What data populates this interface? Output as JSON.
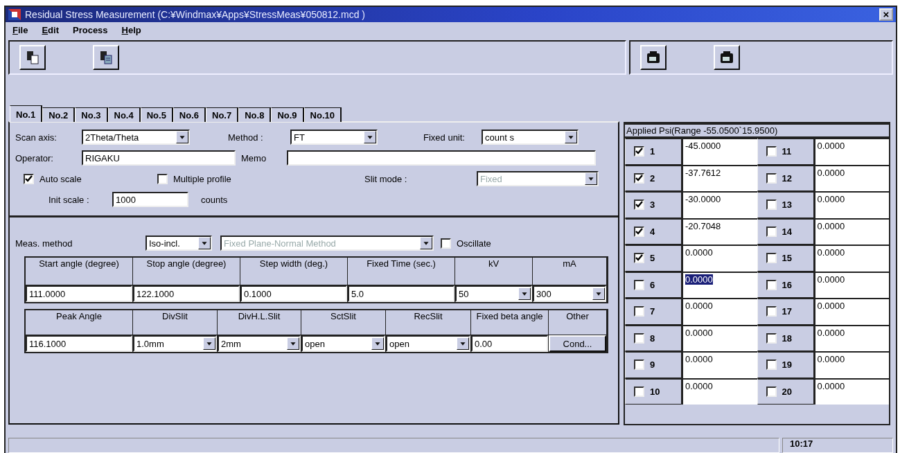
{
  "window": {
    "title": "Residual Stress Measurement (C:¥Windmax¥Apps¥StressMeas¥050812.mcd )",
    "close": "×"
  },
  "menu": [
    {
      "label": "File",
      "underline_first": true
    },
    {
      "label": "Edit",
      "underline_first": true
    },
    {
      "label": "Process",
      "underline_first": false
    },
    {
      "label": "Help",
      "underline_first": true
    }
  ],
  "toolbar": {
    "left": [
      {
        "kind": "copy"
      },
      {
        "kind": "paste"
      }
    ],
    "right": [
      {
        "kind": "camera"
      },
      {
        "kind": "camera"
      }
    ]
  },
  "tabs": [
    {
      "label": "No.1",
      "selected": true
    },
    {
      "label": "No.2",
      "selected": false
    },
    {
      "label": "No.3",
      "selected": false
    },
    {
      "label": "No.4",
      "selected": false
    },
    {
      "label": "No.5",
      "selected": false
    },
    {
      "label": "No.6",
      "selected": false
    },
    {
      "label": "No.7",
      "selected": false
    },
    {
      "label": "No.8",
      "selected": false
    },
    {
      "label": "No.9",
      "selected": false
    },
    {
      "label": "No.10",
      "selected": false
    }
  ],
  "settings": {
    "scan_axis": {
      "label": "Scan axis:",
      "value": "2Theta/Theta"
    },
    "method": {
      "label": "Method  :",
      "value": "FT"
    },
    "fixed_unit": {
      "label": "Fixed unit:",
      "value": "count s"
    },
    "operator": {
      "label": "Operator:",
      "value": "RIGAKU"
    },
    "memo": {
      "label": "Memo"
    },
    "auto_scale": {
      "label": "Auto scale",
      "checked": true
    },
    "multiple_profile": {
      "label": "Multiple profile",
      "checked": false
    },
    "slit_mode": {
      "label": "Slit mode :",
      "value": "Fixed",
      "disabled": true
    },
    "init_scale": {
      "label": "Init scale :",
      "value": "1000",
      "unit": "counts"
    }
  },
  "measurement": {
    "meas_method": {
      "label": "Meas. method",
      "value": "Iso-incl."
    },
    "plane_method": {
      "value": "Fixed Plane-Normal Method",
      "disabled": true
    },
    "oscillate": {
      "label": "Oscillate",
      "checked": false
    },
    "angle_table": [
      {
        "header": "Start angle (degree)",
        "value": "111.0000",
        "kind": "text"
      },
      {
        "header": "Stop angle (degree)",
        "value": "122.1000",
        "kind": "text"
      },
      {
        "header": "Step width (deg.)",
        "value": "0.1000",
        "kind": "text"
      },
      {
        "header": "Fixed Time (sec.)",
        "value": "5.0",
        "kind": "text"
      },
      {
        "header": "kV",
        "value": "50",
        "kind": "dropdown"
      },
      {
        "header": "mA",
        "value": "300",
        "kind": "dropdown"
      }
    ],
    "slit_table": [
      {
        "header": "Peak Angle",
        "value": "116.1000",
        "kind": "text"
      },
      {
        "header": "DivSlit",
        "value": "1.0mm",
        "kind": "dropdown"
      },
      {
        "header": "DivH.L.Slit",
        "value": "2mm",
        "kind": "dropdown"
      },
      {
        "header": "SctSlit",
        "value": "open",
        "kind": "dropdown"
      },
      {
        "header": "RecSlit",
        "value": "open",
        "kind": "dropdown"
      },
      {
        "header": "Fixed beta angle",
        "value": "0.00",
        "kind": "text"
      },
      {
        "header": "Other",
        "value": "Cond...",
        "kind": "button"
      }
    ]
  },
  "psi": {
    "title": "Applied Psi(Range -55.0500`15.9500)",
    "rows": [
      {
        "number": "1",
        "checked": true,
        "value": "-45.0000",
        "selected": false
      },
      {
        "number": "2",
        "checked": true,
        "value": "-37.7612",
        "selected": false
      },
      {
        "number": "3",
        "checked": true,
        "value": "-30.0000",
        "selected": false
      },
      {
        "number": "4",
        "checked": true,
        "value": "-20.7048",
        "selected": false
      },
      {
        "number": "5",
        "checked": true,
        "value": "0.0000",
        "selected": false
      },
      {
        "number": "6",
        "checked": false,
        "value": "0.0000",
        "selected": true
      },
      {
        "number": "7",
        "checked": false,
        "value": "0.0000",
        "selected": false
      },
      {
        "number": "8",
        "checked": false,
        "value": "0.0000",
        "selected": false
      },
      {
        "number": "9",
        "checked": false,
        "value": "0.0000",
        "selected": false
      },
      {
        "number": "10",
        "checked": false,
        "value": "0.0000",
        "selected": false
      },
      {
        "number": "11",
        "checked": false,
        "value": "0.0000",
        "selected": false
      },
      {
        "number": "12",
        "checked": false,
        "value": "0.0000",
        "selected": false
      },
      {
        "number": "13",
        "checked": false,
        "value": "0.0000",
        "selected": false
      },
      {
        "number": "14",
        "checked": false,
        "value": "0.0000",
        "selected": false
      },
      {
        "number": "15",
        "checked": false,
        "value": "0.0000",
        "selected": false
      },
      {
        "number": "16",
        "checked": false,
        "value": "0.0000",
        "selected": false
      },
      {
        "number": "17",
        "checked": false,
        "value": "0.0000",
        "selected": false
      },
      {
        "number": "18",
        "checked": false,
        "value": "0.0000",
        "selected": false
      },
      {
        "number": "19",
        "checked": false,
        "value": "0.0000",
        "selected": false
      },
      {
        "number": "20",
        "checked": false,
        "value": "0.0000",
        "selected": false
      }
    ]
  },
  "status_bar": {
    "time": "10:17"
  }
}
